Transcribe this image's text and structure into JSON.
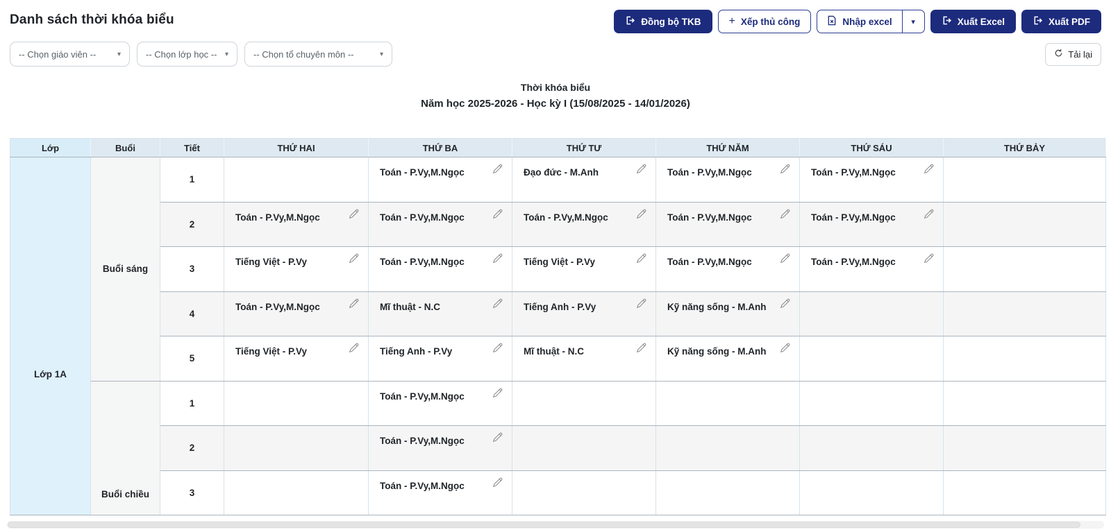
{
  "page": {
    "title": "Danh sách thời khóa biểu"
  },
  "toolbar": {
    "sync_label": "Đồng bộ TKB",
    "manual_label": "Xếp thủ công",
    "import_label": "Nhập excel",
    "export_excel_label": "Xuất Excel",
    "export_pdf_label": "Xuất PDF",
    "caret_glyph": "▾",
    "plus_glyph": "+"
  },
  "filters": {
    "teacher_placeholder": "-- Chọn giáo viên --",
    "class_placeholder": "-- Chọn lớp học --",
    "department_placeholder": "-- Chọn tổ chuyên môn --",
    "reload_label": "Tải lại",
    "caret_glyph": "▾"
  },
  "timetable": {
    "title": "Thời khóa biểu",
    "subtitle": "Năm học 2025-2026 - Học kỳ I (15/08/2025 - 14/01/2026)",
    "columns": [
      "Lớp",
      "Buổi",
      "Tiết",
      "THỨ HAI",
      "THỨ BA",
      "THỨ TƯ",
      "THỨ NĂM",
      "THỨ SÁU",
      "THỨ BẢY"
    ],
    "class_name": "Lớp 1A",
    "sessions": [
      {
        "name": "Buổi sáng",
        "periods": [
          {
            "tiet": "1",
            "cells": [
              "",
              "Toán - P.Vy,M.Ngọc",
              "Đạo đức - M.Anh",
              "Toán - P.Vy,M.Ngọc",
              "Toán - P.Vy,M.Ngọc",
              ""
            ]
          },
          {
            "tiet": "2",
            "cells": [
              "Toán - P.Vy,M.Ngọc",
              "Toán - P.Vy,M.Ngọc",
              "Toán - P.Vy,M.Ngọc",
              "Toán - P.Vy,M.Ngọc",
              "Toán - P.Vy,M.Ngọc",
              ""
            ]
          },
          {
            "tiet": "3",
            "cells": [
              "Tiếng Việt - P.Vy",
              "Toán - P.Vy,M.Ngọc",
              "Tiếng Việt - P.Vy",
              "Toán - P.Vy,M.Ngọc",
              "Toán - P.Vy,M.Ngọc",
              ""
            ]
          },
          {
            "tiet": "4",
            "cells": [
              "Toán - P.Vy,M.Ngọc",
              "Mĩ thuật - N.C",
              "Tiếng Anh - P.Vy",
              "Kỹ năng sống - M.Anh",
              "",
              ""
            ]
          },
          {
            "tiet": "5",
            "cells": [
              "Tiếng Việt - P.Vy",
              "Tiếng Anh - P.Vy",
              "Mĩ thuật - N.C",
              "Kỹ năng sống - M.Anh",
              "",
              ""
            ]
          }
        ]
      },
      {
        "name": "Buổi chiều",
        "periods": [
          {
            "tiet": "1",
            "cells": [
              "",
              "Toán - P.Vy,M.Ngọc",
              "",
              "",
              "",
              ""
            ]
          },
          {
            "tiet": "2",
            "cells": [
              "",
              "Toán - P.Vy,M.Ngọc",
              "",
              "",
              "",
              ""
            ]
          },
          {
            "tiet": "3",
            "cells": [
              "",
              "Toán - P.Vy,M.Ngọc",
              "",
              "",
              "",
              ""
            ]
          }
        ]
      }
    ]
  },
  "colors": {
    "accent_navy": "#1d2b7d",
    "header_bg": "#dee9f2",
    "class_header_bg": "#d9edf8",
    "class_col_bg": "#dff1fb",
    "session_col_bg": "#f5f6f6",
    "stripe_bg": "#f5f5f5",
    "grid_vertical": "#d5e3ee",
    "grid_horizontal": "#a9b4bd"
  }
}
